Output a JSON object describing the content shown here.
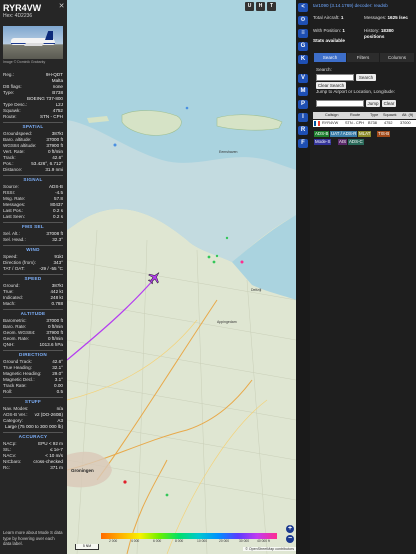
{
  "aircraft": {
    "callsign": "RYR4VW",
    "hex_label": "Hex: 4D2236",
    "photo_credit": "Image © Dominik Grabarky"
  },
  "info_rows": [
    {
      "k": "Reg.:",
      "v": "9H-QDT"
    },
    {
      "k": "",
      "v": "Malta"
    },
    {
      "k": "DB flags:",
      "v": "none"
    },
    {
      "k": "Type:",
      "v": "B738"
    },
    {
      "k": "",
      "v": "BOEING 737-800"
    },
    {
      "k": "Type Desc.:",
      "v": "L2J"
    },
    {
      "k": "Squawk:",
      "v": "4752"
    },
    {
      "k": "Route:",
      "v": "STN - CPH"
    }
  ],
  "sections": {
    "spatial": "SPATIAL",
    "signal": "SIGNAL",
    "fms": "FMS SEL",
    "wind": "WIND",
    "speed": "SPEED",
    "altitude": "ALTITUDE",
    "direction": "DIRECTION",
    "stuff": "STUFF",
    "accuracy": "ACCURACY"
  },
  "spatial_rows": [
    {
      "k": "Groundspeed:",
      "v": "387kt"
    },
    {
      "k": "Baro. altitude:",
      "v": "37000 ft"
    },
    {
      "k": "WGS84 altitude:",
      "v": "37900 ft"
    },
    {
      "k": "Vert. Rate:",
      "v": "0 ft/min"
    },
    {
      "k": "Track:",
      "v": "42.6°"
    },
    {
      "k": "Pos.:",
      "v": "53.426°, 6.712°"
    },
    {
      "k": "Distance:",
      "v": "31.9 nmi"
    }
  ],
  "signal_rows": [
    {
      "k": "Source:",
      "v": "ADS-B"
    },
    {
      "k": "RSSI:",
      "v": "-4.5"
    },
    {
      "k": "Msg. Rate:",
      "v": "57.8"
    },
    {
      "k": "Messages:",
      "v": "80437"
    },
    {
      "k": "Last Pos.:",
      "v": "0.2 s"
    },
    {
      "k": "Last Seen:",
      "v": "0.2 s"
    }
  ],
  "fms_rows": [
    {
      "k": "Sel. Alt.:",
      "v": "37008 ft"
    },
    {
      "k": "Sel. Head.:",
      "v": "32.3°"
    }
  ],
  "wind_rows": [
    {
      "k": "Speed:",
      "v": "91kt"
    },
    {
      "k": "Direction (from):",
      "v": "343°"
    },
    {
      "k": "TAT / OAT:",
      "v": "-29 / -55 °C"
    }
  ],
  "speed_rows": [
    {
      "k": "Ground:",
      "v": "387kt"
    },
    {
      "k": "True:",
      "v": "442 kt"
    },
    {
      "k": "Indicated:",
      "v": "248 kt"
    },
    {
      "k": "Mach:",
      "v": "0.788"
    }
  ],
  "altitude_rows": [
    {
      "k": "Barometric:",
      "v": "37000 ft"
    },
    {
      "k": "Baro. Rate:",
      "v": "0 ft/min"
    },
    {
      "k": "Geom. WGS84:",
      "v": "37900 ft"
    },
    {
      "k": "Geom. Rate:",
      "v": "0 ft/min"
    },
    {
      "k": "QNH:",
      "v": "1013.6 hPa"
    }
  ],
  "direction_rows": [
    {
      "k": "Ground Track:",
      "v": "42.6°"
    },
    {
      "k": "True Heading:",
      "v": "32.1°"
    },
    {
      "k": "Magnetic Heading:",
      "v": "29.0°"
    },
    {
      "k": "Magnetic Decl.:",
      "v": "3.1°"
    },
    {
      "k": "Track Rate:",
      "v": "0.00"
    },
    {
      "k": "Roll:",
      "v": "0.5"
    }
  ],
  "stuff_rows": [
    {
      "k": "Nav. Modes:",
      "v": "n/a"
    },
    {
      "k": "ADS-B Ver.:",
      "v": "v2 (DO-260B)"
    },
    {
      "k": "Category:",
      "v": "A3"
    },
    {
      "k": "",
      "v": "Large (75 000 to 300 000 lb)"
    }
  ],
  "accuracy_rows": [
    {
      "k": "NACp:",
      "v": "EPU < 92 m"
    },
    {
      "k": "SIL:",
      "v": "≤ 1e-7"
    },
    {
      "k": "NACv:",
      "v": "< 10 m/s"
    },
    {
      "k": "NICbaro:",
      "v": "cross-checked"
    },
    {
      "k": "Rc:",
      "v": "371 m"
    }
  ],
  "hint": "Learn more about Mode S data type by hovering over each data label.",
  "map": {
    "buttons": [
      "U",
      "H",
      "T"
    ],
    "zoom_in": "+",
    "zoom_out": "−",
    "scale": "5 NM",
    "attribution": "© OpenStreetMap contributors",
    "city": "Groningen",
    "colorbar_labels": [
      "2 000",
      "4 000",
      "6 000",
      "8 000",
      "10 000",
      "20 000",
      "30 000",
      "40 000 ft"
    ],
    "place_labels": [
      "Eemshaven",
      "Delfzijl",
      "Appingedam"
    ]
  },
  "side_icons": [
    "<",
    "G",
    "K",
    "V",
    "M",
    "P",
    "I",
    "R",
    "F"
  ],
  "right": {
    "version_line": "tar1090 (3.14.1769) decoder: readsb",
    "total_label": "Total Aircraft:",
    "total_value": "1",
    "messages_label": "Messages:",
    "messages_value": "1625 /sec",
    "with_pos_label": "With Position:",
    "with_pos_value": "1",
    "history_label": "History:",
    "history_value": "18380 positions",
    "stats_label": "Stats available",
    "tabs": [
      "Search",
      "Filters",
      "Columns"
    ],
    "search_label": "Search:",
    "search_button": "Search",
    "clear_search": "Clear Search",
    "jump_label": "Jump to Airport or Location, Longitude:",
    "jump_button": "Jump",
    "clear_button": "Clear",
    "columns": [
      "Callsign",
      "Route",
      "Type",
      "Squawk",
      "Alt. (ft)"
    ],
    "row": [
      "RYR4VW",
      "STN - CPH",
      "B738",
      "4752",
      "37000"
    ],
    "legend_chips": [
      {
        "label": "ADS-B",
        "color": "#1e7f2e"
      },
      {
        "label": "UAT / ADS-R",
        "color": "#3b7ea8"
      },
      {
        "label": "MLAT",
        "color": "#8a8a2a"
      },
      {
        "label": "TIS-B",
        "color": "#a14a1a"
      },
      {
        "label": "Mode-S",
        "color": "#333399"
      },
      {
        "label": "AIS",
        "color": "#5a2a6a"
      },
      {
        "label": "ADS-C",
        "color": "#2a6a5a"
      }
    ]
  }
}
